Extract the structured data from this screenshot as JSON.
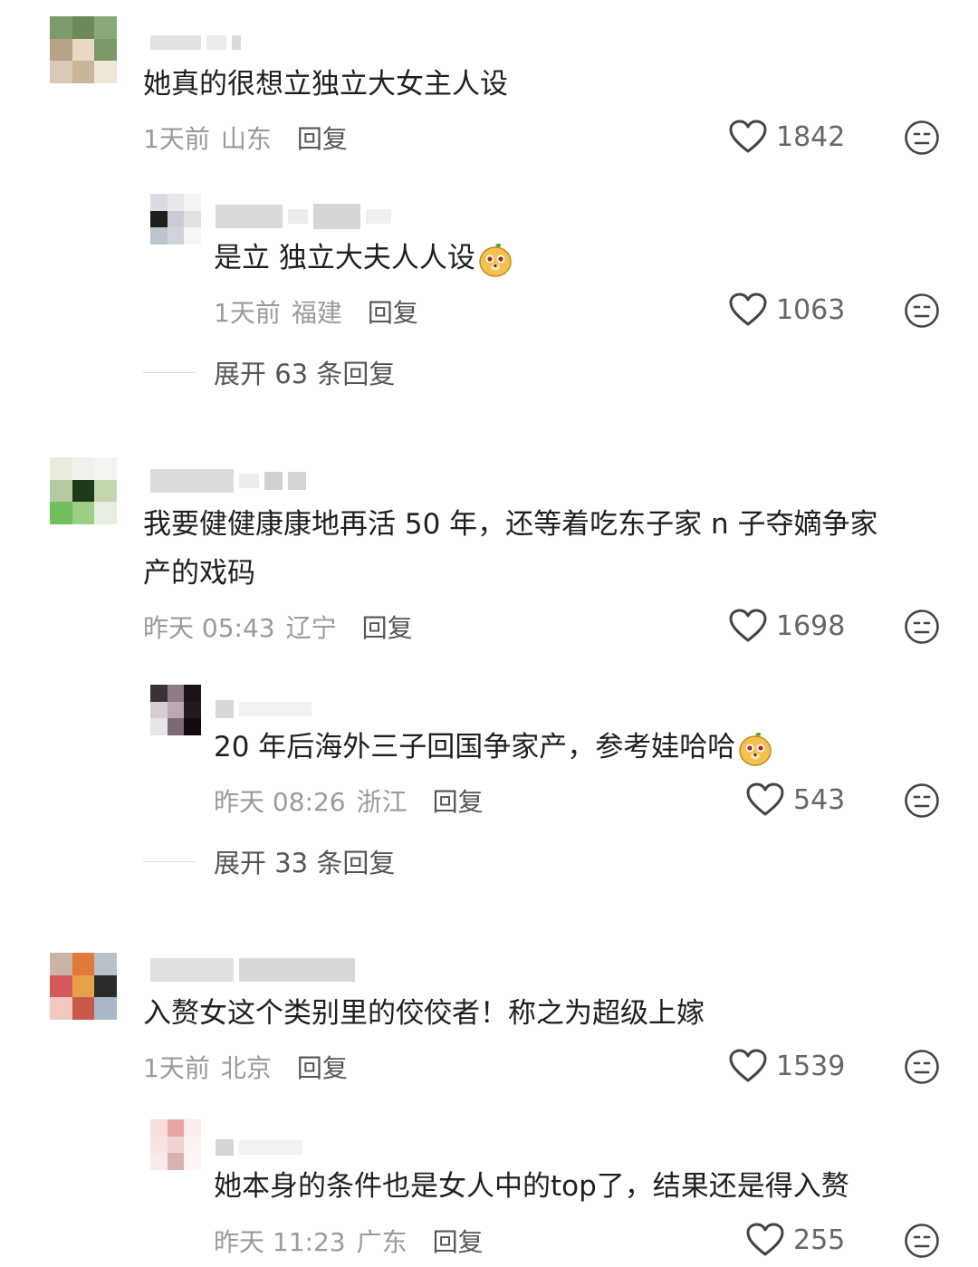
{
  "comments": [
    {
      "text": "她真的很想立独立大女主人设",
      "time": "1天前",
      "location": "山东",
      "reply_label": "回复",
      "likes": "1842",
      "replies": [
        {
          "text": "是立 独立大夫人人设",
          "has_emoji": true,
          "time": "1天前",
          "location": "福建",
          "reply_label": "回复",
          "likes": "1063"
        }
      ],
      "expand_label": "展开 63 条回复"
    },
    {
      "text_line1": "我要健健康康地再活 50 年，还等着吃东子家 n 子夺嫡争家",
      "text_line2": "产的戏码",
      "time": "昨天 05:43",
      "location": "辽宁",
      "reply_label": "回复",
      "likes": "1698",
      "replies": [
        {
          "text": "20 年后海外三子回国争家产，参考娃哈哈",
          "has_emoji": true,
          "time": "昨天 08:26",
          "location": "浙江",
          "reply_label": "回复",
          "likes": "543"
        }
      ],
      "expand_label": "展开 33 条回复"
    },
    {
      "text": "入赘女这个类别里的佼佼者！称之为超级上嫁",
      "time": "1天前",
      "location": "北京",
      "reply_label": "回复",
      "likes": "1539",
      "replies": [
        {
          "text": "她本身的条件也是女人中的top了，结果还是得入赘",
          "has_emoji": false,
          "time": "昨天 11:23",
          "location": "广东",
          "reply_label": "回复",
          "likes": "255"
        }
      ]
    }
  ],
  "colors": {
    "text": "#1f1f1f",
    "meta": "#9a9a9a",
    "reply": "#555555",
    "like_count": "#666666"
  },
  "icons": {
    "like": "heart-outline-icon",
    "reaction": "meh-face-icon",
    "emoji": "meerkat-emoji-icon"
  }
}
